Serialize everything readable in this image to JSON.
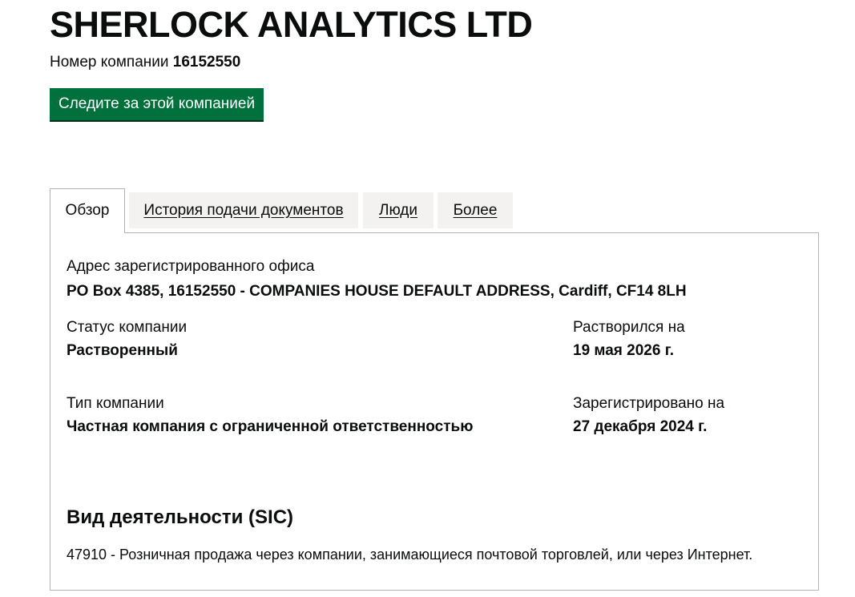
{
  "company": {
    "name": "SHERLOCK ANALYTICS LTD",
    "number_label": "Номер компании",
    "number": "16152550",
    "follow_button": "Следите за этой компанией"
  },
  "tabs": [
    {
      "label": "Обзор",
      "selected": true
    },
    {
      "label": "История подачи документов",
      "selected": false
    },
    {
      "label": "Люди",
      "selected": false
    },
    {
      "label": "Более",
      "selected": false
    }
  ],
  "overview": {
    "registered_office_label": "Адрес зарегистрированного офиса",
    "registered_office_value": "PO Box 4385, 16152550 - COMPANIES HOUSE DEFAULT ADDRESS, Cardiff, CF14 8LH",
    "status_label": "Статус компании",
    "status_value": "Растворенный",
    "dissolved_label": "Растворился на",
    "dissolved_value": "19 мая 2026 г.",
    "type_label": "Тип компании",
    "type_value": "Частная компания с ограниченной ответственностью",
    "incorporated_label": "Зарегистрировано на",
    "incorporated_value": "27 декабря 2024 г.",
    "sic_heading": "Вид деятельности (SIC)",
    "sic_items": [
      "47910 - Розничная продажа через компании, занимающиеся почтовой торговлей, или через Интернет."
    ]
  },
  "colors": {
    "primary_button": "#00703c",
    "tab_background": "#f3f2f1",
    "border": "#b1b4b6",
    "text": "#0b0c0c"
  }
}
